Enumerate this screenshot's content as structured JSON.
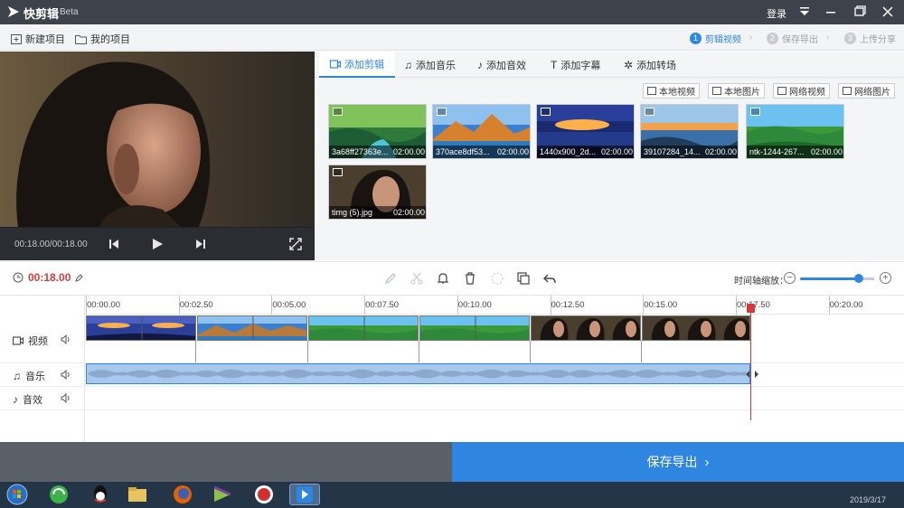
{
  "app": {
    "title": "快剪辑",
    "beta": "Beta",
    "login": "登录"
  },
  "menubar": {
    "new_project": "新建项目",
    "my_projects": "我的项目"
  },
  "steps": [
    {
      "num": "1",
      "label": "剪辑视频",
      "active": true
    },
    {
      "num": "2",
      "label": "保存导出",
      "active": false
    },
    {
      "num": "3",
      "label": "上传分享",
      "active": false
    }
  ],
  "preview": {
    "timecode": "00:18.00/00:18.00"
  },
  "tabs": [
    "添加剪辑",
    "添加音乐",
    "添加音效",
    "添加字幕",
    "添加转场"
  ],
  "sources": [
    "本地视频",
    "本地图片",
    "网络视频",
    "网络图片"
  ],
  "media": [
    {
      "name": "3a68ff27363e...",
      "duration": "02:00.00"
    },
    {
      "name": "370ace8df53...",
      "duration": "02:00.00"
    },
    {
      "name": "1440x900_2d...",
      "duration": "02:00.00"
    },
    {
      "name": "39107284_14...",
      "duration": "02:00.00"
    },
    {
      "name": "ntk-1244-267...",
      "duration": "02:00.00"
    },
    {
      "name": "timg (5).jpg",
      "duration": "02:00.00"
    }
  ],
  "timeline": {
    "current_time": "00:18.00",
    "zoom_label": "时间轴缩放：",
    "zoom_level": 0.85,
    "ticks": [
      "00:00.00",
      "00:02.50",
      "00:05.00",
      "00:07.50",
      "00:10.00",
      "00:12.50",
      "00:15.00",
      "00:17.50",
      "00:20.00"
    ],
    "tracks": {
      "video": "视频",
      "music": "音乐",
      "effect": "音效"
    }
  },
  "save": {
    "label": "保存导出"
  },
  "taskbar": {
    "clock": "2019/3/17"
  },
  "colors": {
    "accent": "#2f86e0",
    "playhead": "#d33b3b",
    "titlebar": "#3e434b"
  }
}
